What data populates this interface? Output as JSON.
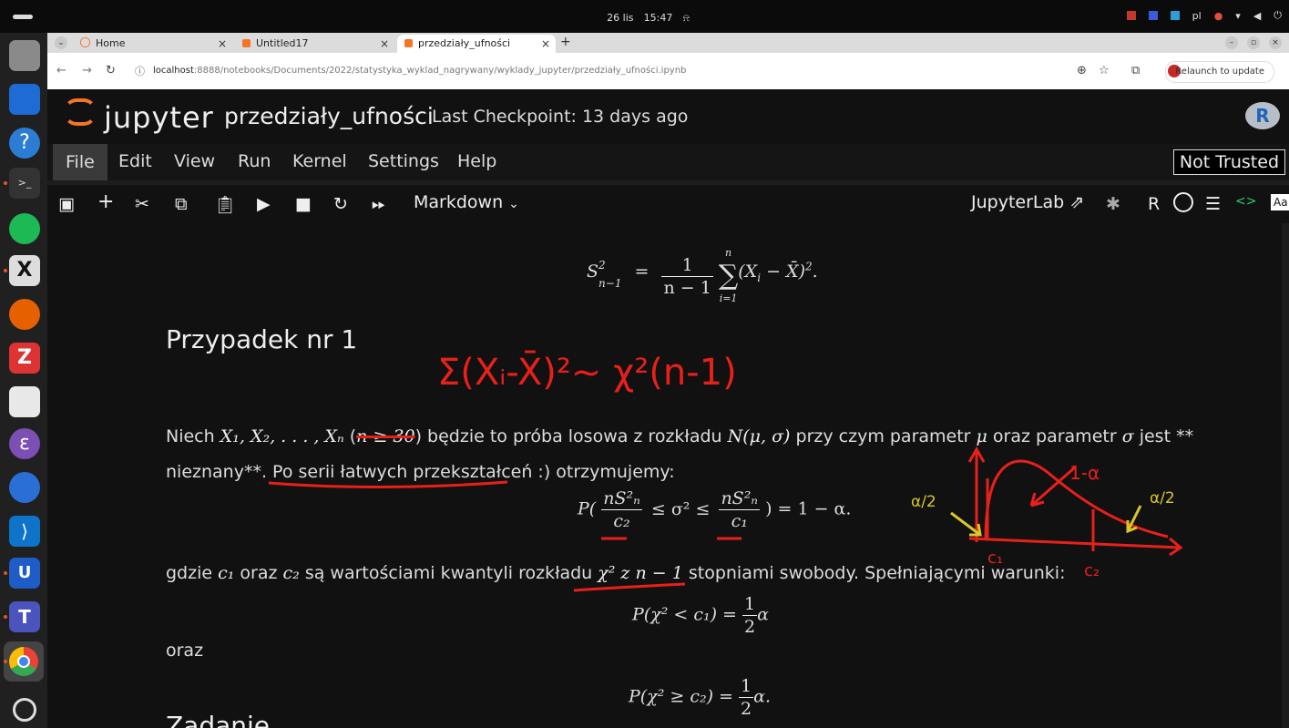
{
  "system": {
    "date": "26 lis",
    "time": "15:47",
    "lang": "pl"
  },
  "browser": {
    "tabs": [
      {
        "label": "Home"
      },
      {
        "label": "Untitled17"
      },
      {
        "label": "przedziały_ufności"
      }
    ],
    "url_host": "localhost",
    "url_path": ":8888/notebooks/Documents/2022/statystyka_wyklad_nagrywany/wyklady_jupyter/przedziały_ufności.ipynb",
    "relaunch_label": "Relaunch to update"
  },
  "jupyter": {
    "logo_text": "jupyter",
    "notebook_title": "przedziały_ufności",
    "checkpoint": "Last Checkpoint: 13 days ago",
    "menu": [
      "File",
      "Edit",
      "View",
      "Run",
      "Kernel",
      "Settings",
      "Help"
    ],
    "not_trusted": "Not Trusted",
    "cell_type": "Markdown",
    "jupyterlab_link": "JupyterLab",
    "kernel_name": "R",
    "kernel_logo": "R"
  },
  "notebook": {
    "formula_top": {
      "lhs": "S",
      "lhs_sup": "2",
      "lhs_sub": "n−1",
      "eq": "=",
      "frac_num": "1",
      "frac_den": "n − 1",
      "sum_top": "n",
      "sum_bottom": "i=1",
      "body": "(X",
      "body_sub": "i",
      "body_mid": " − X̄)",
      "body_sup": "2",
      "end": "."
    },
    "heading": "Przypadek nr 1",
    "para1": {
      "p1": "Niech ",
      "vars": "X₁, X₂, . . . , Xₙ",
      "p2": " (",
      "cond": "n ≥ 30",
      "p3": ") będzie to próba losowa z rozkładu ",
      "dist": "N(μ, σ)",
      "p4": " przy czym parametr ",
      "mu": "μ",
      "p5": " oraz parametr ",
      "sigma": "σ",
      "p6": " jest **",
      "line2a": "nieznany**. ",
      "line2b": "Po serii łatwych przekształceń",
      "line2c": " :) otrzymujemy:"
    },
    "formula_main": {
      "prefix": "P(",
      "num1": "nS²ₙ",
      "den1": "c₂",
      "mid": "≤ σ² ≤",
      "num2": "nS²ₙ",
      "den2": "c₁",
      "suffix": ") = 1 − α."
    },
    "para2": {
      "p1": "gdzie ",
      "c1": "c₁",
      "p2": " oraz ",
      "c2": "c₂",
      "p3": " są wartościami kwantyli rozkładu ",
      "chi": "χ² z n − 1",
      "p4": " stopniami swobody. Spełniającymi warunki:"
    },
    "formula_c1": {
      "lhs": "P(χ² < c₁) =",
      "num": "1",
      "den": "2",
      "end": "α"
    },
    "oraz": "oraz",
    "formula_c2": {
      "lhs": "P(χ² ≥ c₂) =",
      "num": "1",
      "den": "2",
      "end": "α."
    },
    "next_heading": "Zadanie"
  },
  "annotations": {
    "handwritten_formula": "Σ(Xᵢ-X̄)²∼ χ²(n-1)",
    "one_minus_alpha": "1-α",
    "alpha_half_left": "α/2",
    "alpha_half_right": "α/2",
    "c1_label": "c₁",
    "c2_label": "c₂"
  }
}
